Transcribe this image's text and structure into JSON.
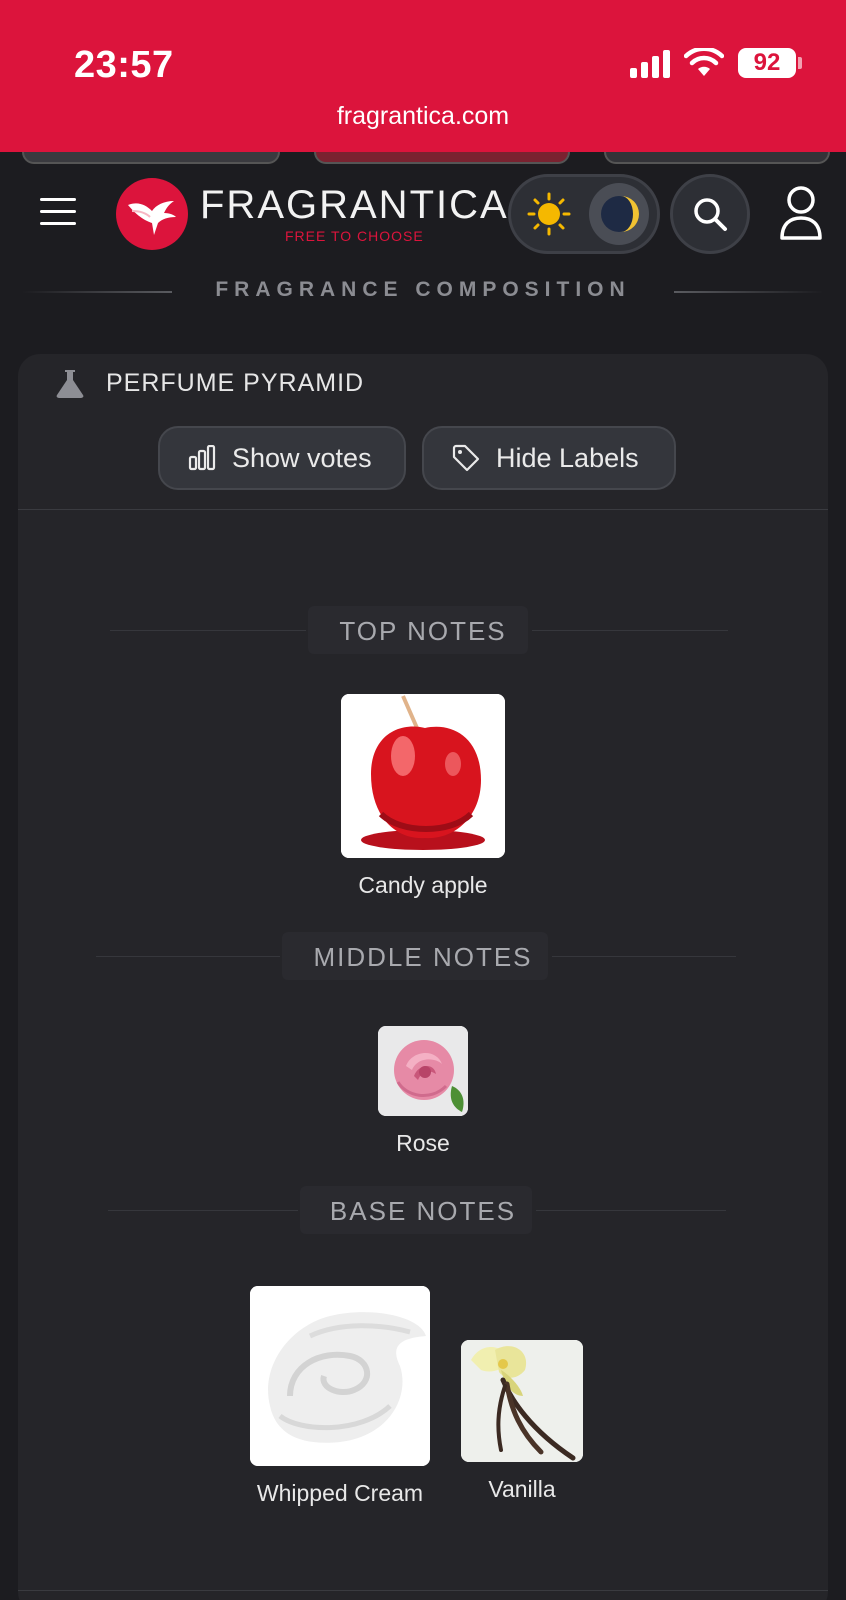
{
  "status_bar": {
    "time": "23:57",
    "battery": "92",
    "url": "fragrantica.com",
    "background_color": "#dc143c"
  },
  "header": {
    "brand": "FRAGRANTICA",
    "tagline": "FREE TO CHOOSE",
    "icons": {
      "menu": "hamburger-menu-icon",
      "logo": "hummingbird-logo-icon",
      "sun": "sun-icon",
      "moon": "moon-icon",
      "search": "search-icon",
      "user": "user-icon"
    }
  },
  "section": {
    "heading": "FRAGRANCE COMPOSITION"
  },
  "pyramid": {
    "title": "PERFUME PYRAMID",
    "show_votes_label": "Show votes",
    "hide_labels_label": "Hide Labels",
    "top_notes_heading": "TOP NOTES",
    "middle_notes_heading": "MIDDLE NOTES",
    "base_notes_heading": "BASE NOTES",
    "top_notes": [
      {
        "name": "Candy apple",
        "image": "candy-apple-image"
      }
    ],
    "middle_notes": [
      {
        "name": "Rose",
        "image": "rose-image"
      }
    ],
    "base_notes": [
      {
        "name": "Whipped Cream",
        "image": "whipped-cream-image"
      },
      {
        "name": "Vanilla",
        "image": "vanilla-image"
      }
    ]
  },
  "colors": {
    "accent": "#dc143c",
    "background": "#1c1c20",
    "card": "#252529"
  }
}
